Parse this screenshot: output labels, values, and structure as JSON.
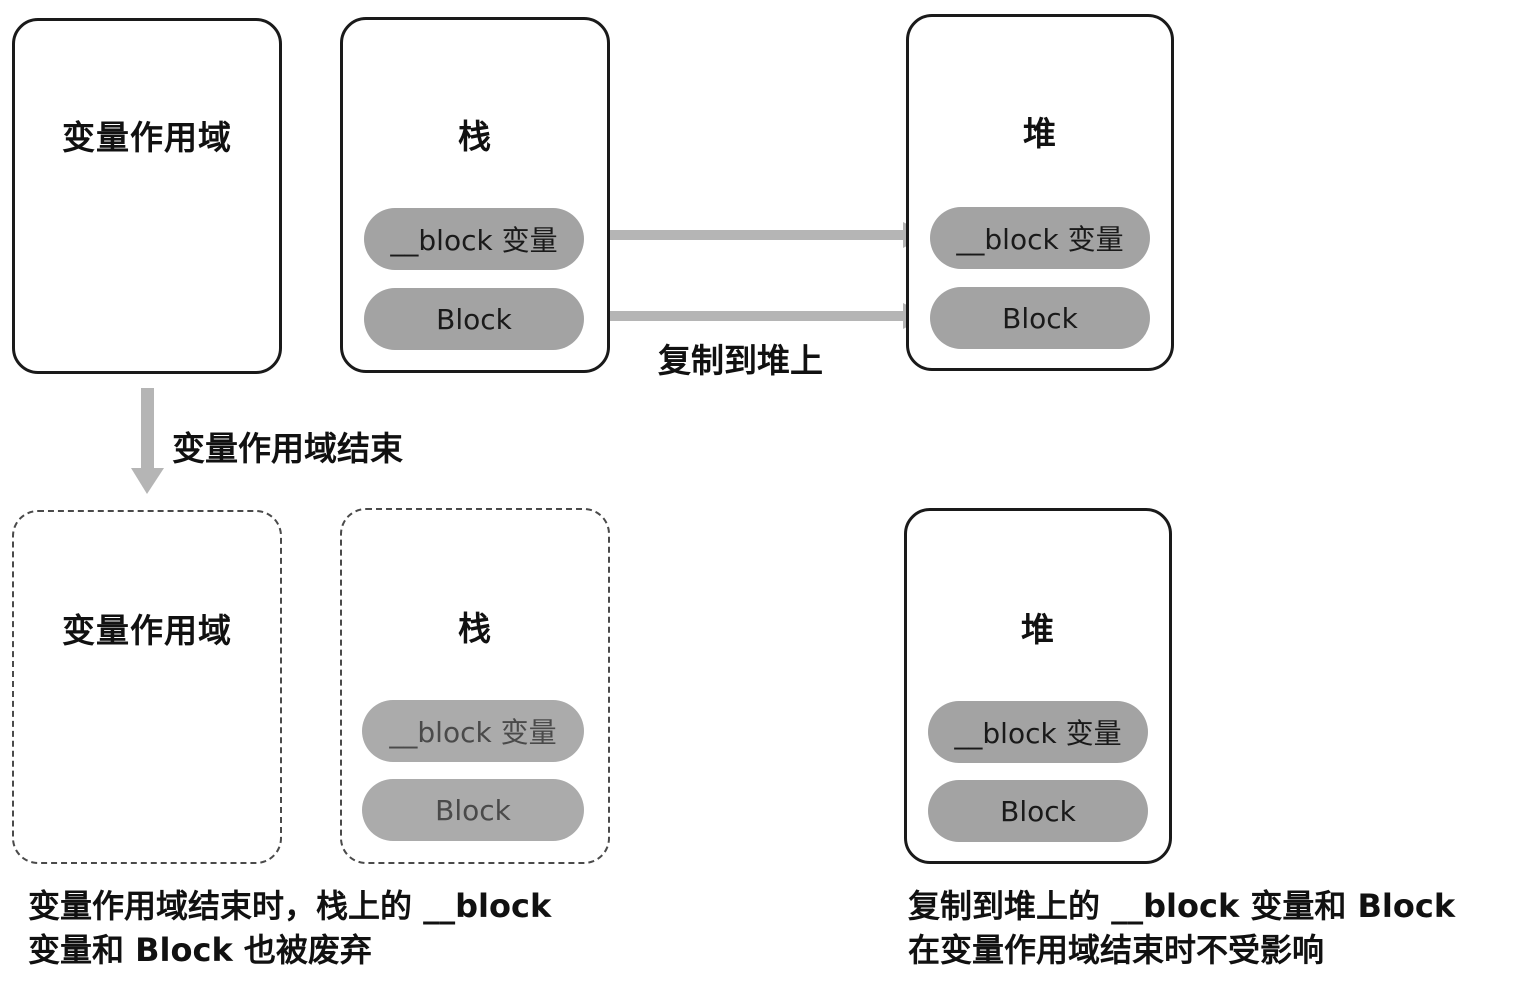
{
  "top": {
    "scope_box": {
      "title": "变量作用域"
    },
    "stack_box": {
      "title": "栈",
      "block_var": "__block 变量",
      "block": "Block"
    },
    "heap_box": {
      "title": "堆",
      "block_var": "__block 变量",
      "block": "Block"
    },
    "copy_label": "复制到堆上"
  },
  "transition_label": "变量作用域结束",
  "bottom": {
    "scope_box": {
      "title": "变量作用域"
    },
    "stack_box": {
      "title": "栈",
      "block_var": "__block 变量",
      "block": "Block"
    },
    "heap_box": {
      "title": "堆",
      "block_var": "__block 变量",
      "block": "Block"
    }
  },
  "captions": {
    "left_line1": "变量作用域结束时，栈上的 __block",
    "left_line2": "变量和 Block 也被废弃",
    "right_line1": "复制到堆上的 __block 变量和 Block",
    "right_line2": "在变量作用域结束时不受影响"
  },
  "colors": {
    "pill": "#a3a3a3",
    "arrow": "#b5b5b5",
    "border": "#1a1a1a"
  }
}
